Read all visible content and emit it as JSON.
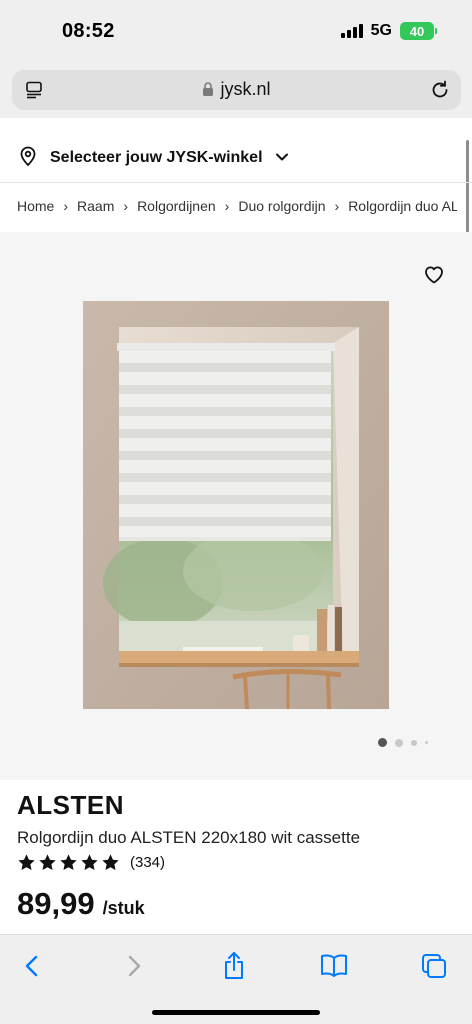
{
  "status_bar": {
    "time": "08:52",
    "network": "5G",
    "battery": "40"
  },
  "browser": {
    "url": "jysk.nl"
  },
  "store_selector": {
    "label": "Selecteer jouw JYSK-winkel"
  },
  "breadcrumb": [
    "Home",
    "Raam",
    "Rolgordijnen",
    "Duo rolgordijn",
    "Rolgordijn duo ALSTEN"
  ],
  "gallery": {
    "image_count": 4,
    "active_index": 0
  },
  "product": {
    "brand": "ALSTEN",
    "name": "Rolgordijn duo ALSTEN 220x180 wit cassette",
    "rating_stars": 5,
    "review_count": "(334)",
    "price": "89,99",
    "unit": "/stuk"
  },
  "toolbar": {
    "icons": [
      "back-icon",
      "forward-icon",
      "share-icon",
      "bookmarks-icon",
      "tabs-icon"
    ]
  },
  "colors": {
    "accent": "#007aff",
    "battery": "#34c759",
    "text": "#111111"
  }
}
